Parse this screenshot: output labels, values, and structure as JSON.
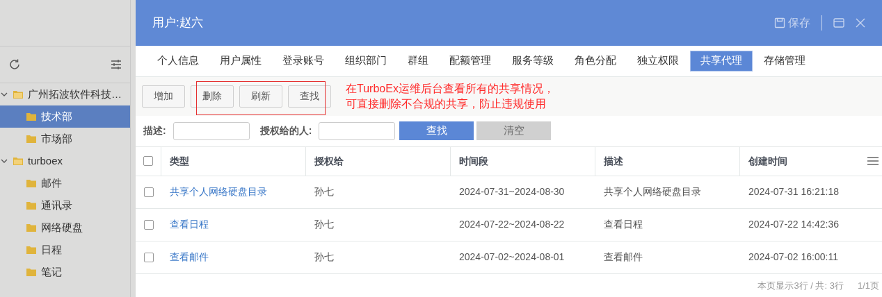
{
  "sidebar": {
    "tree": [
      {
        "label": "广州拓波软件科技…",
        "expanded": true,
        "selected": false,
        "children": [
          {
            "label": "技术部",
            "selected": true
          },
          {
            "label": "市场部",
            "selected": false
          }
        ]
      },
      {
        "label": "turboex",
        "expanded": true,
        "selected": false,
        "children": [
          {
            "label": "邮件",
            "selected": false
          },
          {
            "label": "通讯录",
            "selected": false
          },
          {
            "label": "网络硬盘",
            "selected": false
          },
          {
            "label": "日程",
            "selected": false
          },
          {
            "label": "笔记",
            "selected": false
          }
        ]
      }
    ]
  },
  "dialog": {
    "title": "用户:赵六",
    "save_label": "保存"
  },
  "tabs": [
    {
      "label": "个人信息",
      "selected": false
    },
    {
      "label": "用户属性",
      "selected": false
    },
    {
      "label": "登录账号",
      "selected": false
    },
    {
      "label": "组织部门",
      "selected": false
    },
    {
      "label": "群组",
      "selected": false
    },
    {
      "label": "配额管理",
      "selected": false
    },
    {
      "label": "服务等级",
      "selected": false
    },
    {
      "label": "角色分配",
      "selected": false
    },
    {
      "label": "独立权限",
      "selected": false
    },
    {
      "label": "共享代理",
      "selected": true
    },
    {
      "label": "存储管理",
      "selected": false
    }
  ],
  "toolbar": [
    "增加",
    "删除",
    "刷新",
    "查找"
  ],
  "annotation": {
    "lines": [
      "在TurboEx运维后台查看所有的共享情况，",
      "可直接删除不合规的共享，防止违规使用"
    ]
  },
  "filters": {
    "fields": [
      {
        "label": "描述:"
      },
      {
        "label": "授权给的人:"
      }
    ],
    "search_button": "查找",
    "clear_button": "清空"
  },
  "table": {
    "all_checked": false,
    "columns": [
      "类型",
      "授权给",
      "时间段",
      "描述",
      "创建时间"
    ],
    "rows": [
      {
        "checked": false,
        "cells": [
          "共享个人网络硬盘目录",
          "孙七",
          "2024-07-31~2024-08-30",
          "共享个人网络硬盘目录",
          "2024-07-31 16:21:18"
        ]
      },
      {
        "checked": false,
        "cells": [
          "查看日程",
          "孙七",
          "2024-07-22~2024-08-22",
          "查看日程",
          "2024-07-22 14:42:36"
        ]
      },
      {
        "checked": false,
        "cells": [
          "查看邮件",
          "孙七",
          "2024-07-02~2024-08-01",
          "查看邮件",
          "2024-07-02 16:00:11"
        ]
      }
    ]
  },
  "status_bar": {
    "summary": "本页显示3行 / 共: 3行",
    "pages": "1/1页"
  }
}
